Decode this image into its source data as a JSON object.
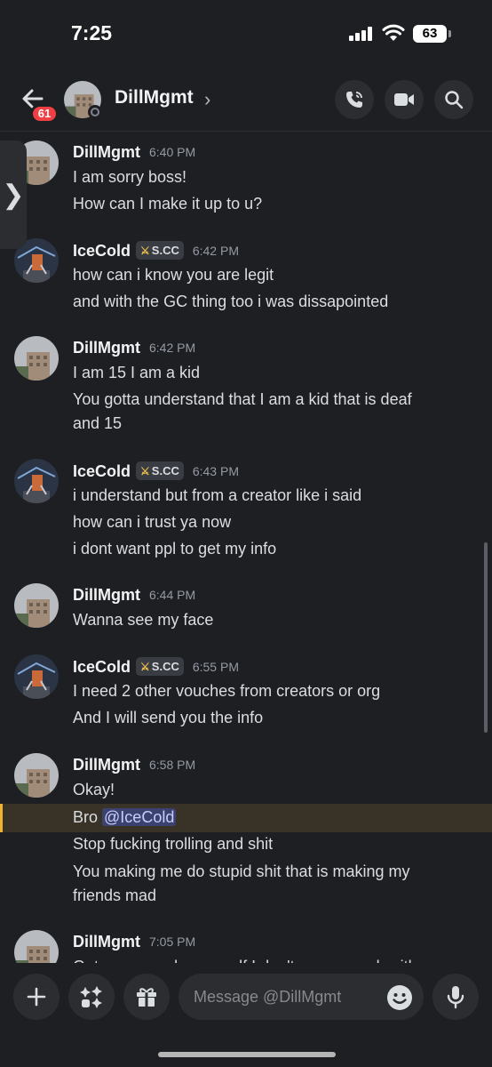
{
  "status_bar": {
    "time": "7:25",
    "battery": "63"
  },
  "header": {
    "back_badge": "61",
    "channel_name": "DillMgmt",
    "chevron": "›",
    "icons": [
      "back-arrow-icon",
      "phone-icon",
      "video-icon",
      "search-icon"
    ]
  },
  "side_handle": "❯",
  "tag_label": "S.CC",
  "messages": [
    {
      "author": "DillMgmt",
      "time": "6:40 PM",
      "lines": [
        "I am sorry boss!",
        "How can I make it up to u?"
      ]
    },
    {
      "author": "IceCold",
      "tag": "S.CC",
      "time": "6:42 PM",
      "lines": [
        "how can i know you are legit",
        "and with the GC thing too i was dissapointed"
      ]
    },
    {
      "author": "DillMgmt",
      "time": "6:42 PM",
      "lines": [
        "I am 15 I am a kid",
        "You gotta understand that I am a kid that is deaf",
        "and 15"
      ]
    },
    {
      "author": "IceCold",
      "tag": "S.CC",
      "time": "6:43 PM",
      "lines": [
        "i understand but from a creator like i said",
        "how can i trust ya now",
        "i dont want ppl to get my info"
      ]
    },
    {
      "author": "DillMgmt",
      "time": "6:44 PM",
      "lines": [
        "Wanna see my face"
      ]
    },
    {
      "author": "IceCold",
      "tag": "S.CC",
      "time": "6:55 PM",
      "lines": [
        "I need 2 other vouches from creators or org",
        "And I will send you the info"
      ]
    },
    {
      "author": "DillMgmt",
      "time": "6:58 PM",
      "lines": [
        "Okay!",
        "Bro",
        "Stop fucking trolling and shit",
        "You making me do stupid shit that is making my",
        "friends mad"
      ],
      "mention": "@IceCold"
    },
    {
      "author": "DillMgmt",
      "time": "7:05 PM",
      "lines": [
        "Get your people yourself I don't wanna work with"
      ]
    }
  ],
  "composer": {
    "placeholder": "Message @DillMgmt",
    "icons": [
      "plus-icon",
      "apps-icon",
      "gift-icon",
      "emoji-icon",
      "microphone-icon"
    ]
  }
}
